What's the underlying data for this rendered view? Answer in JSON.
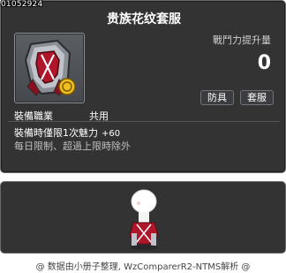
{
  "item_id": "01052924",
  "title": "贵族花纹套服",
  "power": {
    "label": "戰鬥力提升量",
    "value": "0"
  },
  "tags": [
    "防具",
    "套服"
  ],
  "job": {
    "label": "裝備職業",
    "value": "共用"
  },
  "stat": {
    "text": "裝備時僅限1次魅力",
    "bonus": "+60"
  },
  "limit_text": "每日限制、超過上限時除外",
  "footer": "@ 数据由小册子整理, WzComparerR2-NTMS解析 @"
}
